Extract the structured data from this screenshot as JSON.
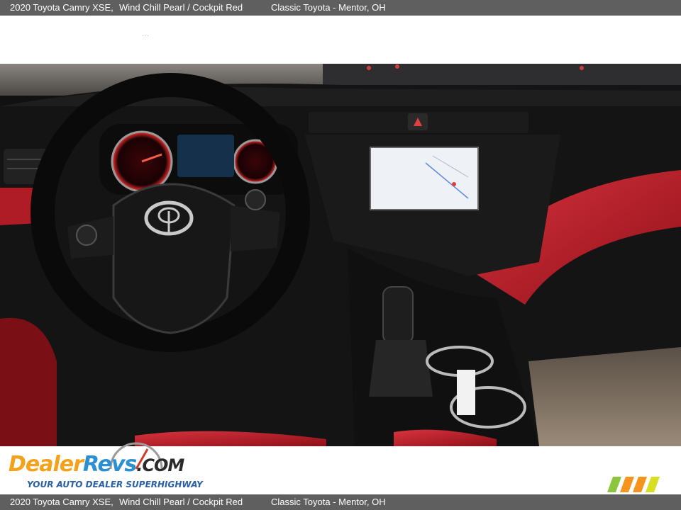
{
  "caption": {
    "title": "2020 Toyota Camry XSE,",
    "color": "Wind Chill Pearl / Cockpit Red",
    "dealer": "Classic Toyota - Mentor, OH"
  },
  "footer": {
    "logo": "DealerRevs.com",
    "tagline": "YOUR AUTO DEALER SUPERHIGHWAY"
  },
  "photo": {
    "subject": "dashboard-interior"
  },
  "colors": {
    "caption_bar": "#5f5f5f",
    "interior_red": "#c8202c",
    "dash_black": "#141414"
  }
}
